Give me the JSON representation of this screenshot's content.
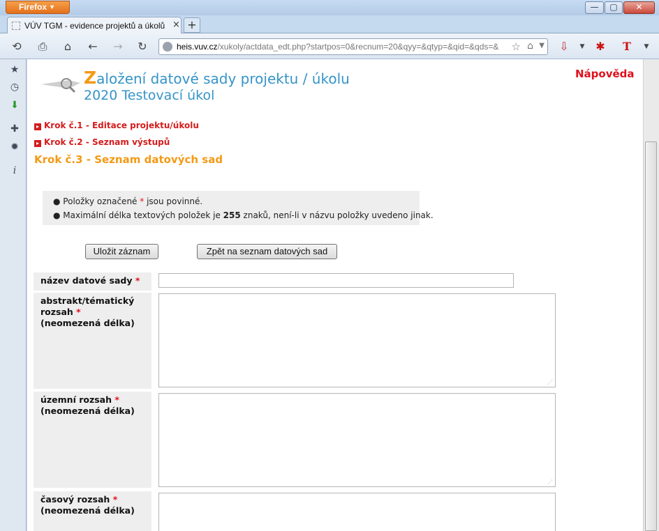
{
  "browser": {
    "menu_label": "Firefox",
    "tab_title": "VÚV TGM - evidence projektů a úkolů - ...",
    "new_tab": "+",
    "url_domain": "heis.vuv.cz",
    "url_path": "/xukoly/actdata_edt.php?startpos=0&recnum=20&qyy=&qtyp=&qid=&qds=&",
    "window_controls": {
      "minimize": "—",
      "maximize": "▢",
      "close": "✕"
    }
  },
  "page": {
    "title_initial": "Z",
    "title_rest": "aložení datové sady projektu / úkolu",
    "subtitle": "2020  Testovací úkol",
    "help": "Nápověda",
    "steps": [
      {
        "label": "Krok č.1 - Editace projektu/úkolu"
      },
      {
        "label": "Krok č.2 - Seznam výstupů"
      }
    ],
    "current_step": "Krok č.3 - Seznam datových sad",
    "notes": {
      "line1_pre": "Položky označené ",
      "line1_star": "*",
      "line1_post": " jsou povinné.",
      "line2_pre": "Maximální délka textových položek je ",
      "line2_bold": "255",
      "line2_post": " znaků, není-li v názvu položky uvedeno jinak."
    },
    "buttons": {
      "save": "Uložit záznam",
      "back": "Zpět na seznam datových sad"
    },
    "fields": [
      {
        "label": "název datové sady",
        "note": "",
        "value": ""
      },
      {
        "label": "abstrakt/tématický rozsah",
        "note": "(neomezená délka)",
        "value": ""
      },
      {
        "label": "územní rozsah",
        "note": "(neomezená délka)",
        "value": ""
      },
      {
        "label": "časový rozsah",
        "note": "(neomezená délka)",
        "value": ""
      }
    ],
    "required_mark": "*"
  },
  "colors": {
    "accent_blue": "#3594c8",
    "accent_orange": "#f39a16",
    "link_red": "#d41c1c"
  }
}
